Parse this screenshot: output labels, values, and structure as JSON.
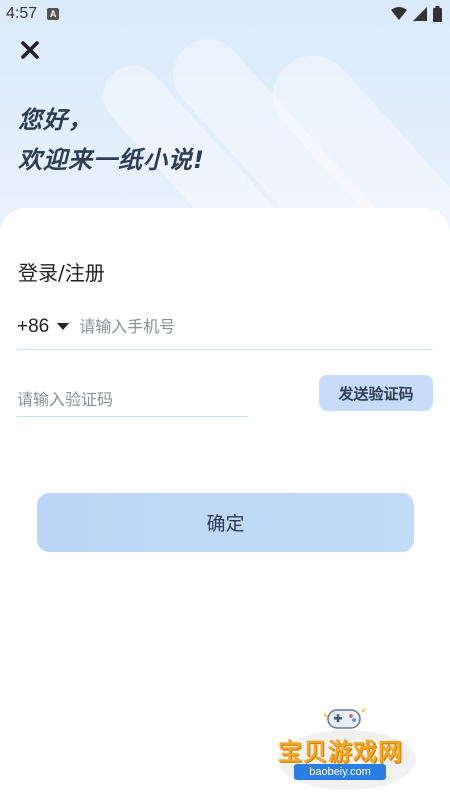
{
  "status_bar": {
    "time": "4:57",
    "notification_icon_letter": "A",
    "icons": [
      "wifi-icon",
      "signal-icon",
      "battery-icon"
    ]
  },
  "header": {
    "close_icon": "close-icon",
    "greeting_line1": "您好，",
    "greeting_line2": "欢迎来一纸小说!"
  },
  "form": {
    "title": "登录/注册",
    "country_code": "+86",
    "phone_placeholder": "请输入手机号",
    "code_placeholder": "请输入验证码",
    "send_code_label": "发送验证码",
    "confirm_label": "确定"
  },
  "watermark": {
    "text": "宝贝游戏网",
    "url": "baobeiy.com"
  },
  "colors": {
    "header_bg": "#dbeafc",
    "button_bg": "#c7dcf8",
    "heading": "#2e3d52"
  }
}
